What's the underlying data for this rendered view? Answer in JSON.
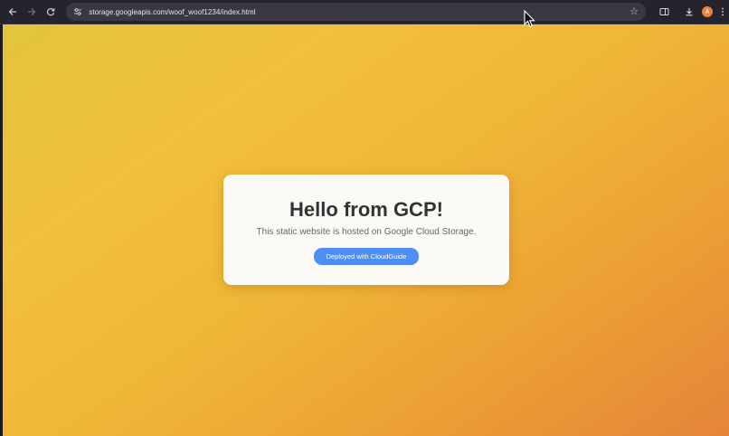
{
  "browser": {
    "url": "storage.googleapis.com/woof_woof1234/index.html",
    "back_icon": "arrow-left-icon",
    "forward_icon": "arrow-right-icon",
    "reload_icon": "reload-icon",
    "site_info_icon": "tune-icon",
    "bookmark_icon": "star-icon",
    "profile_initial": "A",
    "colors": {
      "toolbar": "#25232b",
      "omnibox": "#3a3842",
      "profile": "#e8823a"
    }
  },
  "page": {
    "title": "Hello from GCP!",
    "subtitle": "This static website is hosted on Google Cloud Storage.",
    "button_label": "Deployed with CloudGuide",
    "colors": {
      "gradient_start": "#e2c43c",
      "gradient_end": "#e5843a",
      "card": "#fbfaf6",
      "button": "#4f8ef5"
    }
  }
}
